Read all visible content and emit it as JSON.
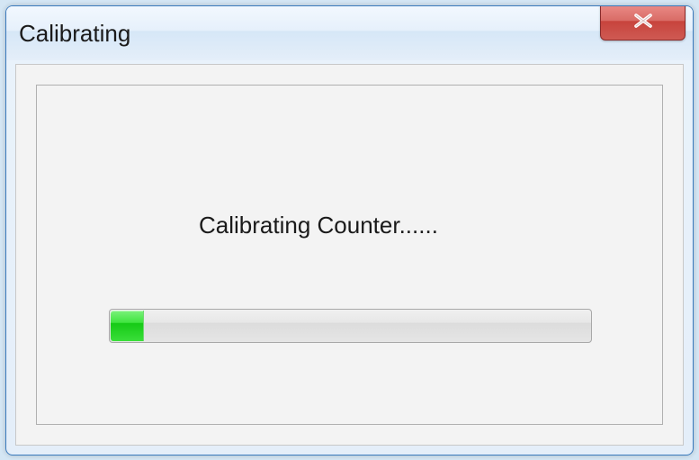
{
  "window": {
    "title": "Calibrating"
  },
  "content": {
    "status_text": "Calibrating Counter......",
    "progress_percent": 7
  },
  "icons": {
    "close": "close-icon"
  }
}
